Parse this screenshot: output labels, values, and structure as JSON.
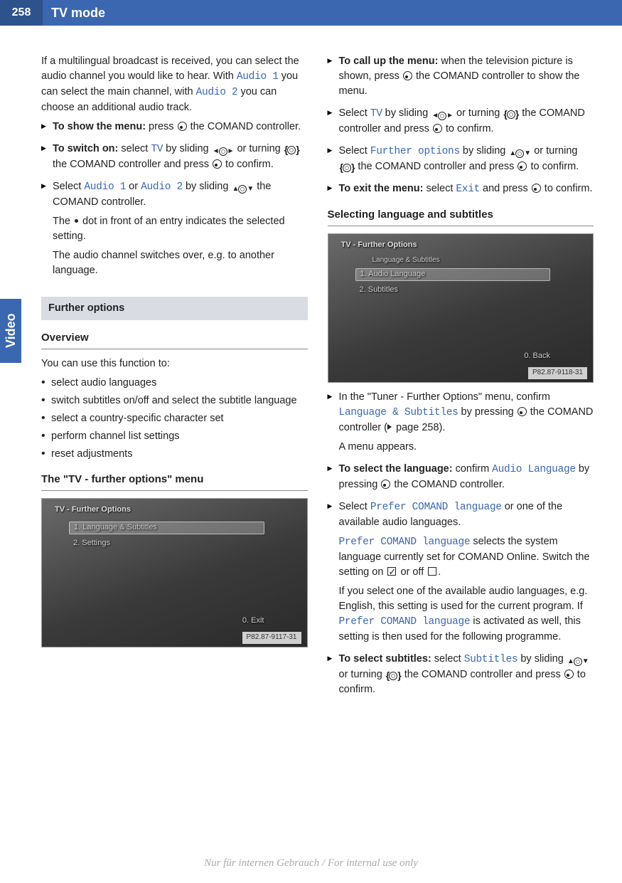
{
  "page_number": "258",
  "page_title": "TV mode",
  "side_tab": "Video",
  "left": {
    "intro_p1a": "If a multilingual broadcast is received, you can select the audio channel you would like to hear. With ",
    "audio1": "Audio 1",
    "intro_p1b": " you can select the main channel, with ",
    "audio2": "Audio 2",
    "intro_p1c": " you can choose an additional audio track.",
    "step1_a": "To show the menu:",
    "step1_b": " press ",
    "step1_c": " the COMAND controller.",
    "step2_a": "To switch on:",
    "step2_b": " select ",
    "tv": "TV",
    "step2_c": " by sliding ",
    "step2_d": " or turning ",
    "step2_e": " the COMAND controller and press ",
    "step2_f": " to confirm.",
    "step3_a": "Select ",
    "step3_b": " or ",
    "step3_c": " by sliding ",
    "step3_d": " the COMAND controller.",
    "step3_note1a": "The ",
    "step3_note1b": " dot in front of an entry indicates the selected setting.",
    "step3_note2": "The audio channel switches over, e.g. to another language.",
    "section_further": "Further options",
    "h3_overview": "Overview",
    "overview_intro": "You can use this function to:",
    "bullets": [
      "select audio languages",
      "switch subtitles on/off and select the subtitle language",
      "select a country-specific character set",
      "perform channel list settings",
      "reset adjustments"
    ],
    "h3_tvmenu": "The \"TV - further options\" menu",
    "shot1": {
      "title": "TV - Further Options",
      "row1": "1. Language & Subtitles",
      "row2": "2. Settings",
      "foot": "0. Exit",
      "code": "P82.87-9117-31"
    }
  },
  "right": {
    "step1_a": "To call up the menu:",
    "step1_b": " when the television picture is shown, press ",
    "step1_c": " the COMAND controller to show the menu.",
    "step2_a": "Select ",
    "tv": "TV",
    "step2_b": " by sliding ",
    "step2_c": " or turning ",
    "step2_d": " the COMAND controller and press ",
    "step2_e": " to confirm.",
    "step3_a": "Select ",
    "further_options": "Further options",
    "step3_b": " by sliding ",
    "step3_c": " or turning ",
    "step3_d": " the COMAND controller and press ",
    "step3_e": " to confirm.",
    "step4_a": "To exit the menu:",
    "step4_b": " select ",
    "exit": "Exit",
    "step4_c": " and press ",
    "step4_d": " to confirm.",
    "h3_lang": "Selecting language and subtitles",
    "shot2": {
      "title": "TV - Further Options",
      "sub": "Language & Subtitles",
      "row1": "1. Audio Language",
      "row2": "2. Subtitles",
      "foot": "0. Back",
      "code": "P82.87-9118-31"
    },
    "step5_a": "In the \"Tuner - Further Options\" menu, confirm ",
    "lang_sub": "Language & Subtitles",
    "step5_b": " by pressing ",
    "step5_c": " the COMAND controller (",
    "step5_d": " page 258).",
    "step5_note": "A menu appears.",
    "step6_a": "To select the language:",
    "step6_b": " confirm ",
    "audio_lang": "Audio Language",
    "step6_c": " by pressing ",
    "step6_d": " the COMAND controller.",
    "step7_a": "Select ",
    "prefer": "Prefer COMAND language",
    "step7_b": " or one of the available audio languages.",
    "step7_c": " selects the system language currently set for COMAND Online. Switch the setting on ",
    "step7_d": " or off ",
    "step7_e": ".",
    "step7_note": "If you select one of the available audio languages, e.g. English, this setting is used for the current program. If ",
    "step7_note2": " is activated as well, this setting is then used for the following programme.",
    "step8_a": "To select subtitles:",
    "step8_b": " select ",
    "subtitles": "Subtitles",
    "step8_c": " by sliding ",
    "step8_d": " or turning ",
    "step8_e": " the COMAND controller and press ",
    "step8_f": " to confirm."
  },
  "footer": "Nur für internen Gebrauch / For internal use only"
}
